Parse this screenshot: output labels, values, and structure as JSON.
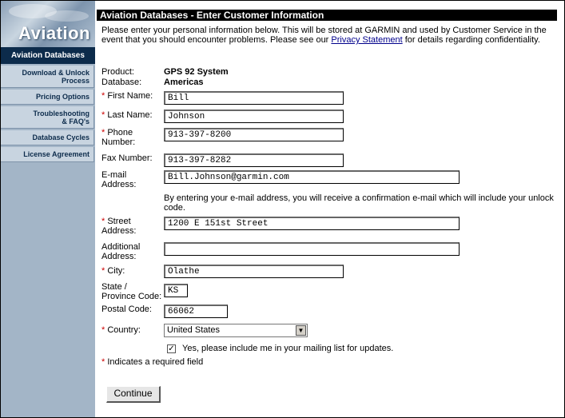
{
  "sidebar": {
    "logo_text": "Aviation",
    "active_item": "Aviation Databases",
    "items": [
      {
        "line1": "Download & Unlock",
        "line2": "Process"
      },
      {
        "line1": "Pricing Options",
        "line2": ""
      },
      {
        "line1": "Troubleshooting",
        "line2": "& FAQ's"
      },
      {
        "line1": "Database Cycles",
        "line2": ""
      },
      {
        "line1": "License Agreement",
        "line2": ""
      }
    ]
  },
  "header": {
    "title": "Aviation Databases - Enter Customer Information"
  },
  "intro": {
    "text_before": "Please enter your personal information below. This will be stored at GARMIN and used by Customer Service in the event that you should encounter problems. Please see our ",
    "link": "Privacy Statement",
    "text_after": " for details regarding confidentiality."
  },
  "product": {
    "label": "Product:",
    "value": "GPS 92 System"
  },
  "database": {
    "label": "Database:",
    "value": "Americas"
  },
  "form": {
    "required_mark": "*",
    "first_name": {
      "label": "First Name:",
      "value": "Bill"
    },
    "last_name": {
      "label": "Last Name:",
      "value": "Johnson"
    },
    "phone": {
      "label_1": "Phone",
      "label_2": "Number:",
      "value": "913-397-8200"
    },
    "fax": {
      "label": "Fax Number:",
      "value": "913-397-8282"
    },
    "email": {
      "label_1": "E-mail",
      "label_2": "Address:",
      "value": "Bill.Johnson@garmin.com"
    },
    "email_note": "By entering your e-mail address, you will receive a confirmation e-mail which will include your unlock code.",
    "street": {
      "label_1": "Street",
      "label_2": "Address:",
      "value": "1200 E 151st Street"
    },
    "additional": {
      "label_1": "Additional",
      "label_2": "Address:",
      "value": ""
    },
    "city": {
      "label": "City:",
      "value": "Olathe"
    },
    "state": {
      "label_1": "State /",
      "label_2": "Province Code:",
      "value": "KS"
    },
    "postal": {
      "label": "Postal Code:",
      "value": "66062"
    },
    "country": {
      "label": "Country:",
      "value": "United States"
    },
    "mailing_list": {
      "checked": true,
      "label": "Yes, please include me in your mailing list for updates."
    },
    "required_note": "Indicates a required field",
    "continue_label": "Continue"
  }
}
